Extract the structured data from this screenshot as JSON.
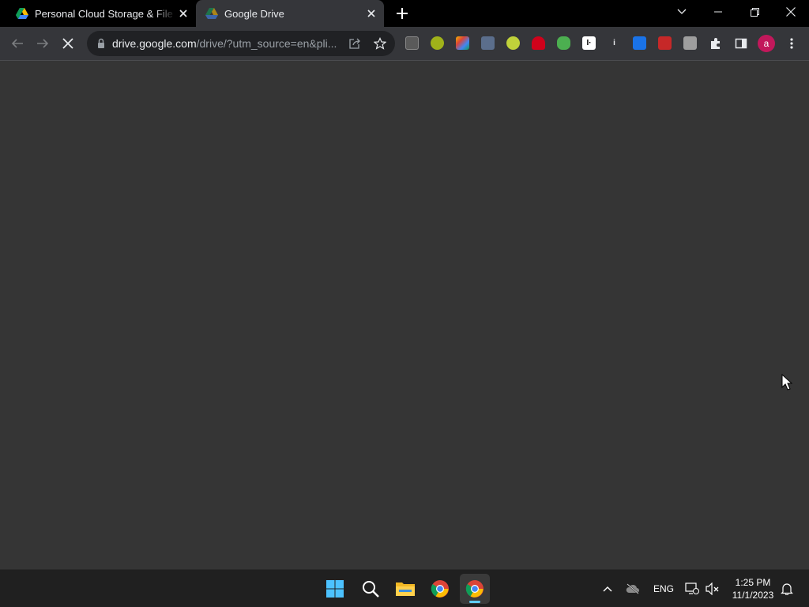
{
  "browser": {
    "tabs": [
      {
        "title": "Personal Cloud Storage & File Sharing",
        "active": false,
        "favicon": "google-drive-icon"
      },
      {
        "title": "Google Drive",
        "active": true,
        "favicon": "google-drive-icon"
      }
    ],
    "new_tab_icon": "plus-icon",
    "window_controls": [
      "tab-search-icon",
      "minimize-icon",
      "restore-icon",
      "close-icon"
    ]
  },
  "toolbar": {
    "url_host": "drive.google.com",
    "url_path": "/drive/?utm_source=en&pli...",
    "loading": true,
    "extensions": [
      "extension-1-icon",
      "extension-2-icon",
      "extension-3-icon",
      "extension-4-icon",
      "extension-5-icon",
      "extension-6-icon",
      "extension-7-icon",
      "extension-8-icon",
      "extension-9-icon",
      "extension-10-icon",
      "extension-11-icon",
      "extension-12-icon"
    ],
    "avatar_letter": "a"
  },
  "taskbar": {
    "apps": [
      "windows-start-icon",
      "search-icon",
      "file-explorer-icon",
      "chrome-icon",
      "chrome-icon"
    ],
    "language": "ENG",
    "time": "1:25 PM",
    "date": "11/1/2023"
  },
  "colors": {
    "page_background": "#353535",
    "toolbar_background": "#35363a",
    "tabstrip_background": "#000000",
    "taskbar_background": "#202020",
    "accent": "#60cdff"
  }
}
